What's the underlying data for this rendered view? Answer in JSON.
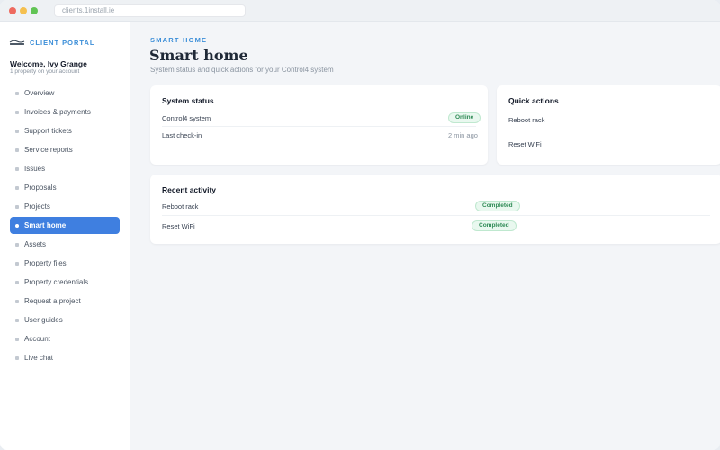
{
  "browser": {
    "url": "clients.1install.ie"
  },
  "sidebar": {
    "brand": "CLIENT PORTAL",
    "welcome": "Welcome, Ivy Grange",
    "welcome_sub": "1 property on your account",
    "items": [
      {
        "label": "Overview"
      },
      {
        "label": "Invoices & payments"
      },
      {
        "label": "Support tickets"
      },
      {
        "label": "Service reports"
      },
      {
        "label": "Issues"
      },
      {
        "label": "Proposals"
      },
      {
        "label": "Projects"
      },
      {
        "label": "Smart home",
        "active": true
      },
      {
        "label": "Assets"
      },
      {
        "label": "Property files"
      },
      {
        "label": "Property credentials"
      },
      {
        "label": "Request a project"
      },
      {
        "label": "User guides"
      },
      {
        "label": "Account"
      },
      {
        "label": "Live chat"
      }
    ]
  },
  "main": {
    "eyebrow": "SMART HOME",
    "title": "Smart home",
    "subtitle": "System status and quick actions for your Control4 system",
    "system_status": {
      "title": "System status",
      "rows": [
        {
          "label": "Control4 system",
          "value": "Online"
        },
        {
          "label": "Last check-in",
          "value": "2 min ago"
        }
      ]
    },
    "quick_actions": {
      "title": "Quick actions",
      "actions": [
        "Reboot rack",
        "Reset WiFi"
      ]
    },
    "recent_activity": {
      "title": "Recent activity",
      "rows": [
        {
          "label": "Reboot rack",
          "status": "Completed"
        },
        {
          "label": "Reset WiFi",
          "status": "Completed"
        }
      ]
    }
  },
  "colors": {
    "accent": "#3b8ed8",
    "active_nav": "#3f7fe0",
    "success": "#2e8a55"
  },
  "icons": {
    "brand": "company-logo",
    "nav_bullet": "square-bullet"
  }
}
